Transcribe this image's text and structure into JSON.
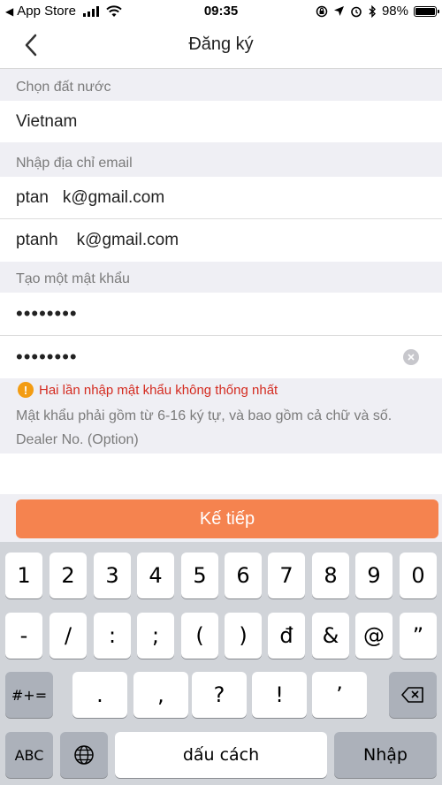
{
  "status_bar": {
    "back_app": "App Store",
    "time": "09:35",
    "battery": "98%",
    "battery_level": 0.98
  },
  "nav": {
    "title": "Đăng ký"
  },
  "form": {
    "country_label": "Chọn đất nước",
    "country_value": "Vietnam",
    "email_label": "Nhập địa chỉ email",
    "email_value": "ptan   k@gmail.com",
    "email_confirm_value": "ptanh    k@gmail.com",
    "password_label": "Tạo một mật khẩu",
    "password_value": "••••••••",
    "password_confirm_value": "••••••••",
    "error_icon": "!",
    "error_message": "Hai lần nhập mật khẩu không thống nhất",
    "password_hint": "Mật khẩu phải gồm từ 6-16 ký tự, và bao gồm cả chữ và số.",
    "dealer_label": "Dealer No. (Option)",
    "dealer_value": "",
    "next_button": "Kế tiếp"
  },
  "colors": {
    "accent": "#f5834f",
    "error": "#d42b20",
    "warning_icon": "#f39c12"
  },
  "keyboard": {
    "row1": [
      "1",
      "2",
      "3",
      "4",
      "5",
      "6",
      "7",
      "8",
      "9",
      "0"
    ],
    "row2": [
      "-",
      "/",
      ":",
      ";",
      "(",
      ")",
      "đ",
      "&",
      "@",
      "”"
    ],
    "row3_mode": "#+=",
    "row3": [
      ".",
      ",",
      "?",
      "!",
      "’"
    ],
    "mode_key": "ABC",
    "space_key": "dấu cách",
    "return_key": "Nhập"
  }
}
